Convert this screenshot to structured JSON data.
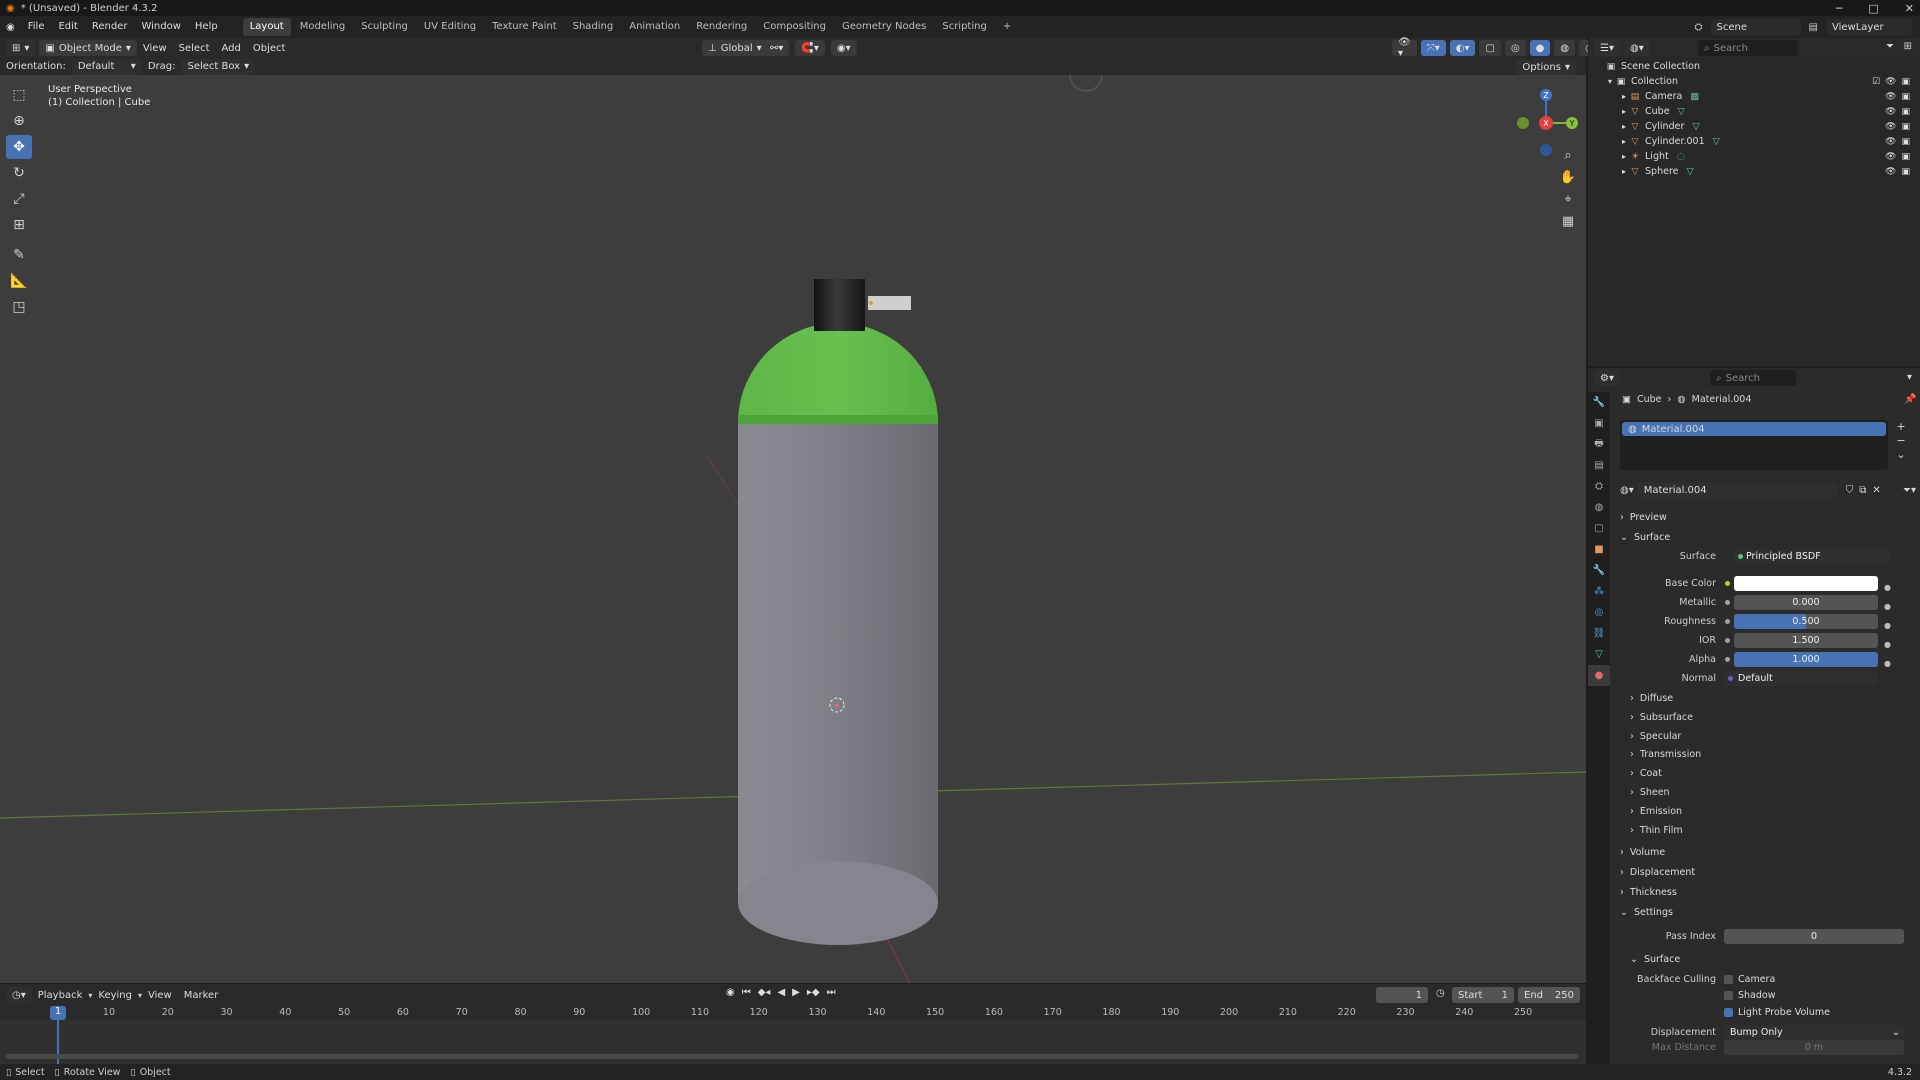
{
  "window": {
    "title": "* (Unsaved) - Blender 4.3.2",
    "minimize": "─",
    "maximize": "□",
    "close": "✕"
  },
  "menu": {
    "items": [
      "File",
      "Edit",
      "Render",
      "Window",
      "Help"
    ]
  },
  "workspaces": [
    "Layout",
    "Modeling",
    "Sculpting",
    "UV Editing",
    "Texture Paint",
    "Shading",
    "Animation",
    "Rendering",
    "Compositing",
    "Geometry Nodes",
    "Scripting"
  ],
  "workspace_add": "+",
  "topright": {
    "scene": "Scene",
    "view_layer": "ViewLayer"
  },
  "viewport_header": {
    "mode": "Object Mode",
    "menus": [
      "View",
      "Select",
      "Add",
      "Object"
    ],
    "transform": "Global",
    "orientation_label": "Orientation:",
    "orientation_value": "Default",
    "drag_label": "Drag:",
    "drag_value": "Select Box",
    "options": "Options"
  },
  "viewport": {
    "perspective": "User Perspective",
    "context": "(1) Collection | Cube",
    "gizmo": {
      "x": "X",
      "y": "Y",
      "z": "Z"
    }
  },
  "outliner": {
    "search_placeholder": "Search",
    "root": "Scene Collection",
    "collection": "Collection",
    "objects": [
      "Camera",
      "Cube",
      "Cylinder",
      "Cylinder.001",
      "Light",
      "Sphere"
    ]
  },
  "properties": {
    "search_placeholder": "Search",
    "breadcrumb_object": "Cube",
    "breadcrumb_material": "Material.004",
    "slot": "Material.004",
    "material_name": "Material.004",
    "sections": {
      "preview": "Preview",
      "surface": "Surface",
      "volume": "Volume",
      "displacement": "Displacement",
      "thickness": "Thickness",
      "settings": "Settings"
    },
    "surface_label": "Surface",
    "surface_value": "Principled BSDF",
    "base_color_label": "Base Color",
    "metallic_label": "Metallic",
    "metallic": "0.000",
    "roughness_label": "Roughness",
    "roughness": "0.500",
    "roughness_fill": 0.5,
    "ior_label": "IOR",
    "ior": "1.500",
    "alpha_label": "Alpha",
    "alpha": "1.000",
    "alpha_fill": 1.0,
    "normal_label": "Normal",
    "normal": "Default",
    "subpanels": [
      "Diffuse",
      "Subsurface",
      "Specular",
      "Transmission",
      "Coat",
      "Sheen",
      "Emission",
      "Thin Film"
    ],
    "pass_index_label": "Pass Index",
    "pass_index": "0",
    "settings_surface": "Surface",
    "backface_label": "Backface Culling",
    "backface_options": [
      "Camera",
      "Shadow",
      "Light Probe Volume"
    ],
    "displacement_label": "Displacement",
    "displacement_value": "Bump Only",
    "max_distance_label": "Max Distance",
    "max_distance": "0 m"
  },
  "timeline": {
    "menus": [
      "Playback",
      "Keying",
      "View",
      "Marker"
    ],
    "current_frame": "1",
    "start_label": "Start",
    "start": "1",
    "end_label": "End",
    "end": "250",
    "ticks": [
      "10",
      "20",
      "30",
      "40",
      "50",
      "60",
      "70",
      "80",
      "90",
      "100",
      "110",
      "120",
      "130",
      "140",
      "150",
      "160",
      "170",
      "180",
      "190",
      "200",
      "210",
      "220",
      "230",
      "240",
      "250"
    ],
    "playhead": "1"
  },
  "statusbar": {
    "select": "Select",
    "rotate": "Rotate View",
    "object": "Object",
    "version": "4.3.2"
  }
}
